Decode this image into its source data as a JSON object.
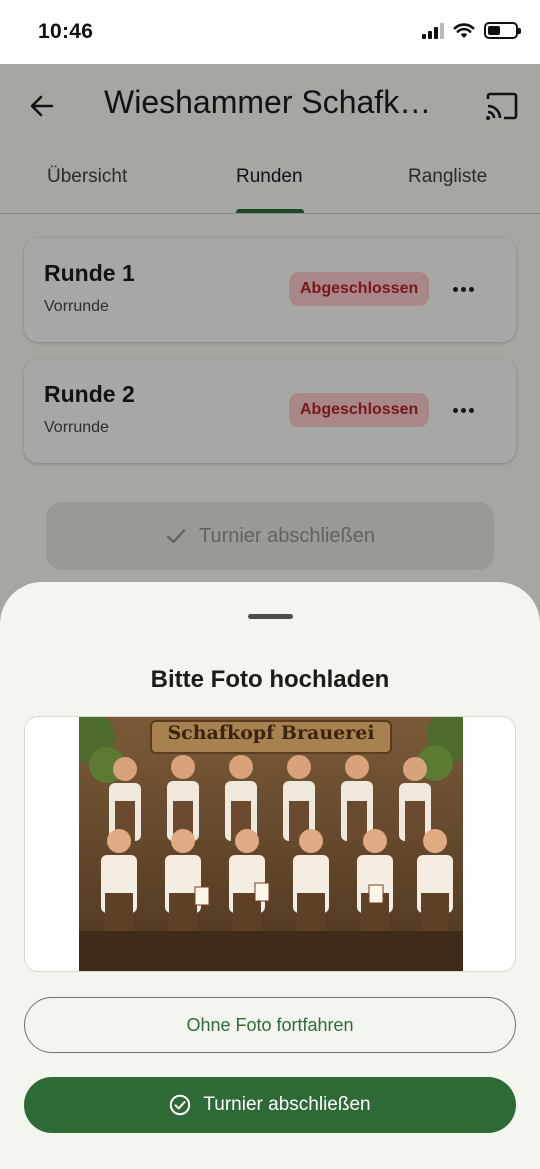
{
  "status_bar": {
    "time": "10:46",
    "icons": [
      "signal-icon",
      "wifi-icon",
      "battery-icon"
    ]
  },
  "app_bar": {
    "title": "Wieshammer Schafkopf-Turnier",
    "back_icon": "arrow-left-icon",
    "cast_icon": "cast-icon"
  },
  "tabs": [
    {
      "label": "Übersicht",
      "selected": false
    },
    {
      "label": "Runden",
      "selected": true
    },
    {
      "label": "Rangliste",
      "selected": false
    }
  ],
  "rounds": [
    {
      "title": "Runde 1",
      "subtitle": "Vorrunde",
      "status": "Abgeschlossen"
    },
    {
      "title": "Runde 2",
      "subtitle": "Vorrunde",
      "status": "Abgeschlossen"
    }
  ],
  "finish_button_disabled": {
    "label": "Turnier abschließen",
    "icon": "check-icon"
  },
  "sheet": {
    "title": "Bitte Foto hochladen",
    "photo": {
      "sign_text": "Schafkopf Brauerei"
    },
    "skip_button": "Ohne Foto fortfahren",
    "confirm_button": {
      "label": "Turnier abschließen",
      "icon": "check-circle-icon"
    }
  },
  "colors": {
    "primary": "#2e6a36",
    "badge_bg": "#f6c7c7",
    "badge_text": "#b42329",
    "sheet_bg": "#f2f6ee",
    "surface": "#f3f6f0"
  }
}
